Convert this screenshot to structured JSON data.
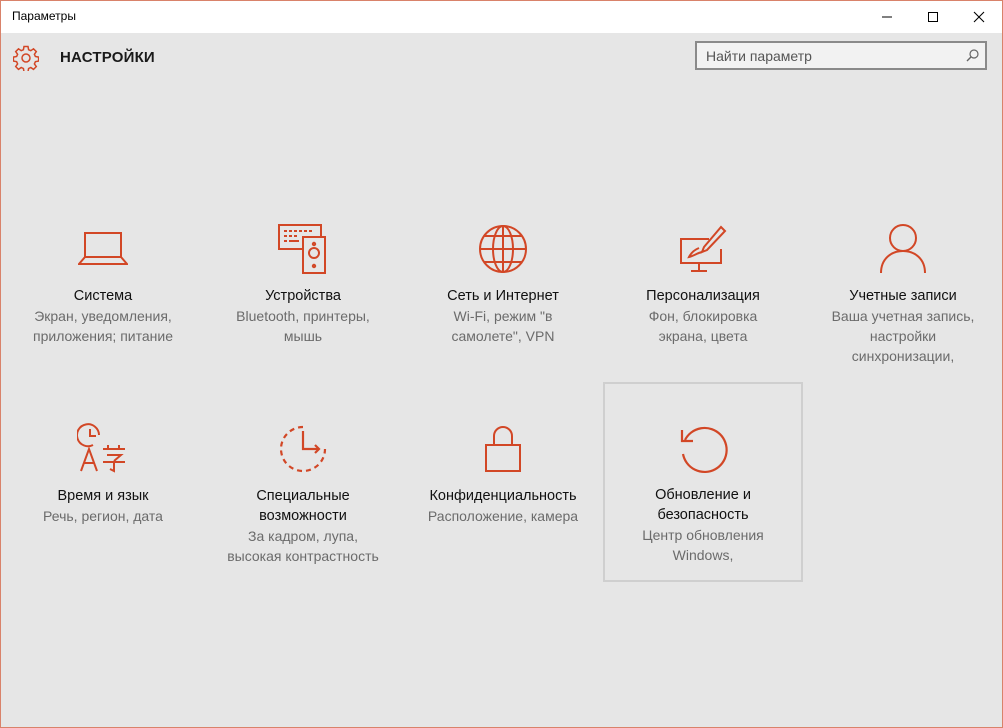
{
  "window": {
    "title": "Параметры",
    "minimize_icon": "minimize-icon",
    "maximize_icon": "maximize-icon",
    "close_icon": "close-icon"
  },
  "header": {
    "app_icon": "gear-icon",
    "title": "НАСТРОЙКИ",
    "search_placeholder": "Найти параметр",
    "search_value": ""
  },
  "accent_color": "#d24726",
  "tiles": [
    {
      "name": "Система",
      "desc_lines": [
        "Экран, уведомления,",
        "приложения; питание"
      ],
      "icon": "laptop-icon"
    },
    {
      "name": "Устройства",
      "desc_lines": [
        "Bluetooth, принтеры,",
        "мышь"
      ],
      "icon": "devices-icon"
    },
    {
      "name": "Сеть и Интернет",
      "desc_lines": [
        "Wi-Fi, режим \"в",
        "самолете\", VPN"
      ],
      "icon": "globe-icon"
    },
    {
      "name": "Персонализация",
      "desc_lines": [
        "Фон, блокировка",
        "экрана, цвета"
      ],
      "icon": "paint-icon"
    },
    {
      "name": "Учетные записи",
      "desc_lines": [
        "Ваша учетная запись,",
        "настройки",
        "синхронизации,"
      ],
      "icon": "person-icon"
    },
    {
      "name": "Время и язык",
      "desc_lines": [
        "Речь, регион, дата"
      ],
      "icon": "time-language-icon"
    },
    {
      "name_lines": [
        "Специальные",
        "возможности"
      ],
      "desc_lines": [
        "За кадром, лупа,",
        "высокая контрастность"
      ],
      "icon": "ease-of-access-icon"
    },
    {
      "name": "Конфиденциальность",
      "desc_lines": [
        "Расположение, камера"
      ],
      "icon": "lock-icon"
    },
    {
      "name_lines": [
        "Обновление и",
        "безопасность"
      ],
      "desc_lines": [
        "Центр обновления",
        "Windows,"
      ],
      "icon": "update-icon",
      "selected": true
    }
  ]
}
